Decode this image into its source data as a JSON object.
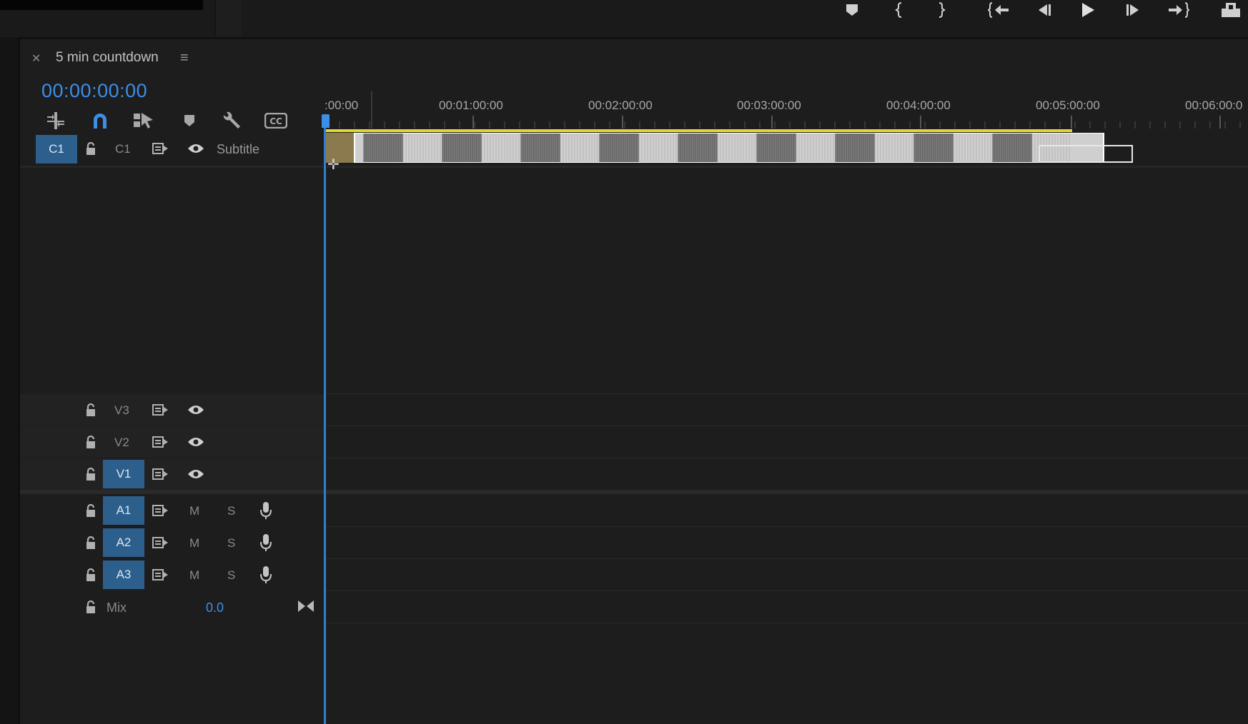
{
  "sequence": {
    "title": "5 min countdown",
    "timecode": "00:00:00:00"
  },
  "ruler": {
    "labels": [
      ":00:00",
      "00:01:00:00",
      "00:02:00:00",
      "00:03:00:00",
      "00:04:00:00",
      "00:05:00:00",
      "00:06:00:0"
    ]
  },
  "tracks": {
    "caption": {
      "target": "C1",
      "label": "C1",
      "name": "Subtitle"
    },
    "video": [
      {
        "label": "V3",
        "targeted": false
      },
      {
        "label": "V2",
        "targeted": false
      },
      {
        "label": "V1",
        "targeted": true
      }
    ],
    "audio": [
      {
        "label": "A1",
        "mute": "M",
        "solo": "S"
      },
      {
        "label": "A2",
        "mute": "M",
        "solo": "S"
      },
      {
        "label": "A3",
        "mute": "M",
        "solo": "S"
      }
    ],
    "mix": {
      "label": "Mix",
      "value": "0.0"
    }
  },
  "icons": {
    "toolbar": [
      "nest-sequence-icon",
      "snap-magnet-icon",
      "linked-selection-icon",
      "add-marker-icon",
      "timeline-settings-wrench-icon",
      "captions-cc-icon"
    ],
    "transport": [
      "marker-icon",
      "mark-in-icon",
      "mark-out-icon",
      "go-to-in-icon",
      "step-back-icon",
      "play-icon",
      "step-forward-icon",
      "go-to-out-icon",
      "export-frame-icon"
    ]
  },
  "colors": {
    "accent": "#3d8ee6",
    "track_target": "#2d5f8c",
    "work_area": "#e3d632",
    "background": "#1d1d1d"
  }
}
